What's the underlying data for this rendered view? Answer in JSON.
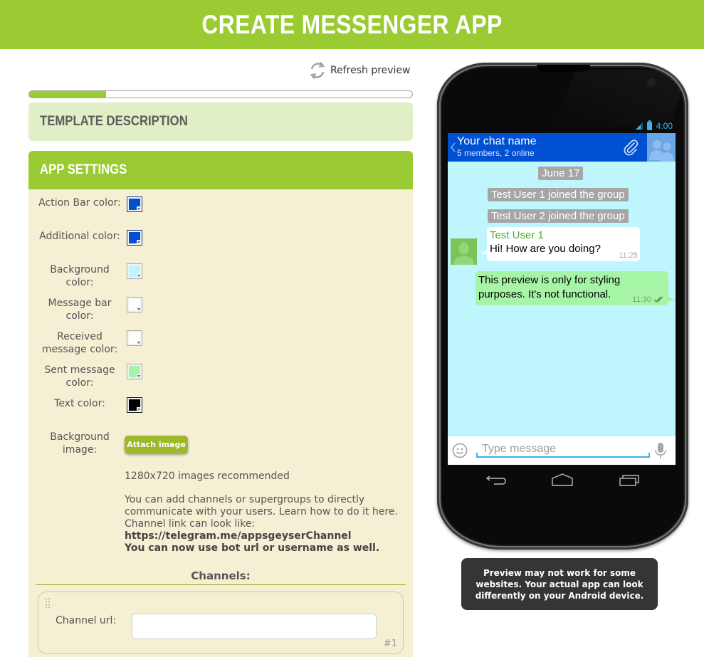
{
  "header": {
    "title": "CREATE MESSENGER APP"
  },
  "toolbar": {
    "refresh_label": "Refresh preview",
    "refresh_icon": "refresh-icon"
  },
  "progress": {
    "percent": 20
  },
  "panels": {
    "template_description": "TEMPLATE DESCRIPTION",
    "app_settings": "APP SETTINGS"
  },
  "settings": {
    "colors": [
      {
        "label": "Action Bar color:",
        "value": "#0050d2"
      },
      {
        "label": "Additional color:",
        "value": "#0050d2"
      },
      {
        "label": "Background color:",
        "value": "#bff6fe"
      },
      {
        "label": "Message bar color:",
        "value": "#ffffff"
      },
      {
        "label": "Received message color:",
        "value": "#ffffff"
      },
      {
        "label": "Sent message color:",
        "value": "#a6f5a6"
      },
      {
        "label": "Text color:",
        "value": "#000000"
      }
    ],
    "background_image_label": "Background image:",
    "attach_button": "Attach image",
    "image_hint": "1280x720 images recommended",
    "info_text": "You can add channels or supergroups to directly communicate with your users. Learn how to do it here. Channel link can look like:",
    "info_link_example": "https://telegram.me/appsgeyserChannel",
    "info_bold_note": "You can now use bot url or username as well.",
    "channels_title": "Channels:",
    "channels": [
      {
        "label": "Channel url:",
        "value": "",
        "number": "#1"
      }
    ]
  },
  "preview": {
    "status_time": "4:00",
    "chat_name": "Your chat name",
    "chat_subtitle": "5 members, 2 online",
    "date_chip": "June 17",
    "system_messages": [
      "Test User 1 joined the group",
      "Test User 2 joined the group"
    ],
    "received": {
      "sender": "Test User 1",
      "text": "Hi! How are you doing?",
      "time": "11:25"
    },
    "sent": {
      "text": "This preview is only for styling purposes. It's not functional.",
      "time": "11:30"
    },
    "input_placeholder": "Type message",
    "colors": {
      "action_bar": "#0050d2",
      "background": "#bff6fe",
      "sent": "#a6f5a6",
      "accent": "#33b5e5"
    }
  },
  "notice": "Preview may not work for some websites. Your actual app can look differently on your Android device."
}
